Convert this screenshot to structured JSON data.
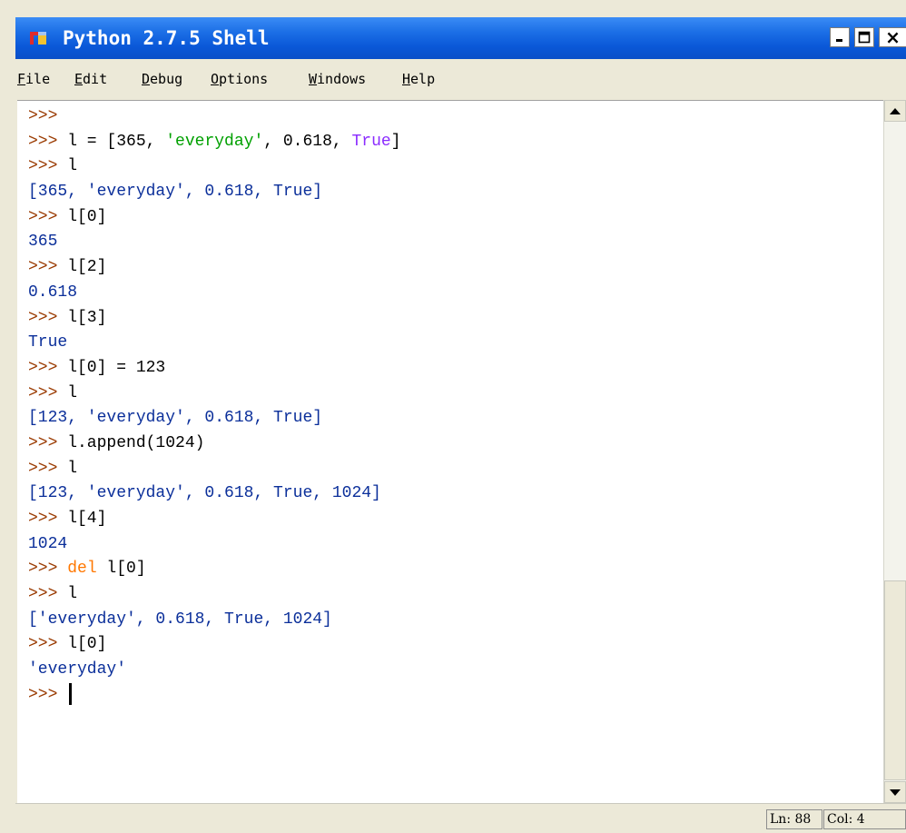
{
  "window": {
    "title": "Python 2.7.5 Shell"
  },
  "menu": [
    {
      "mnemonic": "F",
      "rest": "ile"
    },
    {
      "mnemonic": "E",
      "rest": "dit"
    },
    {
      "mnemonic": "D",
      "rest": "ebug"
    },
    {
      "mnemonic": "O",
      "rest": "ptions"
    },
    {
      "mnemonic": "W",
      "rest": "indows"
    },
    {
      "mnemonic": "H",
      "rest": "elp"
    }
  ],
  "shell": {
    "prompt": ">>>",
    "lines": [
      {
        "kind": "input",
        "segments": []
      },
      {
        "kind": "input",
        "segments": [
          {
            "c": "code",
            "t": " l = [365, "
          },
          {
            "c": "str",
            "t": "'everyday'"
          },
          {
            "c": "code",
            "t": ", 0.618, "
          },
          {
            "c": "builtin",
            "t": "True"
          },
          {
            "c": "code",
            "t": "]"
          }
        ]
      },
      {
        "kind": "input",
        "segments": [
          {
            "c": "code",
            "t": " l"
          }
        ]
      },
      {
        "kind": "output",
        "text": "[365, 'everyday', 0.618, True]"
      },
      {
        "kind": "input",
        "segments": [
          {
            "c": "code",
            "t": " l[0]"
          }
        ]
      },
      {
        "kind": "output",
        "text": "365"
      },
      {
        "kind": "input",
        "segments": [
          {
            "c": "code",
            "t": " l[2]"
          }
        ]
      },
      {
        "kind": "output",
        "text": "0.618"
      },
      {
        "kind": "input",
        "segments": [
          {
            "c": "code",
            "t": " l[3]"
          }
        ]
      },
      {
        "kind": "output",
        "text": "True"
      },
      {
        "kind": "input",
        "segments": [
          {
            "c": "code",
            "t": " l[0] = 123"
          }
        ]
      },
      {
        "kind": "input",
        "segments": [
          {
            "c": "code",
            "t": " l"
          }
        ]
      },
      {
        "kind": "output",
        "text": "[123, 'everyday', 0.618, True]"
      },
      {
        "kind": "input",
        "segments": [
          {
            "c": "code",
            "t": " l.append(1024)"
          }
        ]
      },
      {
        "kind": "input",
        "segments": [
          {
            "c": "code",
            "t": " l"
          }
        ]
      },
      {
        "kind": "output",
        "text": "[123, 'everyday', 0.618, True, 1024]"
      },
      {
        "kind": "input",
        "segments": [
          {
            "c": "code",
            "t": " l[4]"
          }
        ]
      },
      {
        "kind": "output",
        "text": "1024"
      },
      {
        "kind": "input",
        "segments": [
          {
            "c": "code",
            "t": " "
          },
          {
            "c": "kw",
            "t": "del"
          },
          {
            "c": "code",
            "t": " l[0]"
          }
        ]
      },
      {
        "kind": "input",
        "segments": [
          {
            "c": "code",
            "t": " l"
          }
        ]
      },
      {
        "kind": "output",
        "text": "['everyday', 0.618, True, 1024]"
      },
      {
        "kind": "input",
        "segments": [
          {
            "c": "code",
            "t": " l[0]"
          }
        ]
      },
      {
        "kind": "output",
        "text": "'everyday'"
      },
      {
        "kind": "current",
        "segments": [
          {
            "c": "code",
            "t": " "
          }
        ]
      }
    ]
  },
  "status": {
    "ln": "Ln: 88",
    "col": "Col: 4"
  },
  "colors": {
    "titlebar": "#0a58d8",
    "prompt": "#9a3a00",
    "output": "#0b2f9a",
    "string": "#00a000",
    "keyword": "#ff7700",
    "builtin": "#8b2cff"
  }
}
